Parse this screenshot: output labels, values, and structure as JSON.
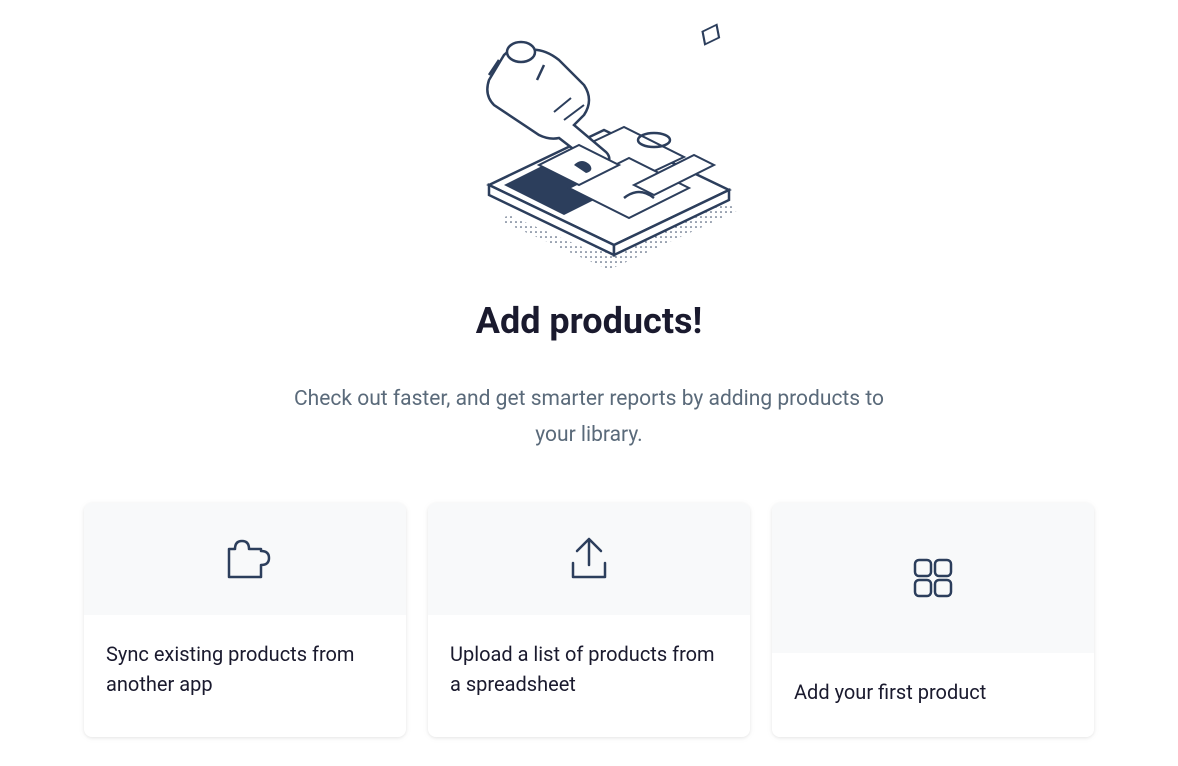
{
  "heading": "Add products!",
  "subheading": "Check out faster, and get smarter reports by adding products to your library.",
  "cards": [
    {
      "icon": "puzzle",
      "text": "Sync existing products from another app"
    },
    {
      "icon": "upload",
      "text": "Upload a list of products from a spreadsheet"
    },
    {
      "icon": "grid",
      "text": "Add your first product"
    }
  ]
}
